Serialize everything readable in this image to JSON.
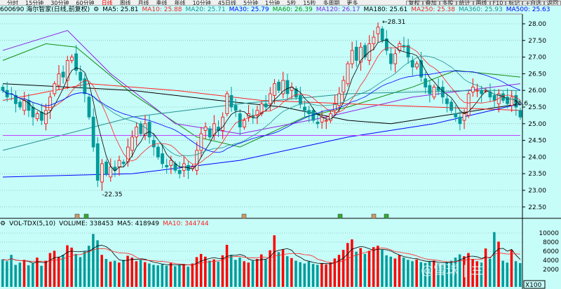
{
  "toolbar": {
    "periods": [
      "分时",
      "15分钟",
      "30分钟",
      "60分钟",
      "日线",
      "周线",
      "月线",
      "季线",
      "年线",
      "10分钟",
      "45日线",
      "5分钟",
      "1分钟",
      "5秒",
      "15秒",
      "多周期",
      "更多"
    ],
    "active": "日线",
    "right_buttons": [
      "复权",
      "叠加",
      "多股",
      "统计",
      "画线",
      "F10",
      "标记",
      "+自选",
      "返回"
    ]
  },
  "legend": {
    "title": "600690 海尔智家(日线,前复权)",
    "ma": [
      {
        "label": "MA5: 25.81",
        "color": "#000000"
      },
      {
        "label": "MA10: 25.88",
        "color": "#ff2020"
      },
      {
        "label": "MA20: 25.71",
        "color": "#209090"
      },
      {
        "label": "MA30: 25.79",
        "color": "#0000ff"
      },
      {
        "label": "MA60: 26.39",
        "color": "#109010"
      },
      {
        "label": "MA120: 26.17",
        "color": "#9020e0"
      },
      {
        "label": "MA180: 25.61",
        "color": "#000000"
      },
      {
        "label": "MA250: 25.38",
        "color": "#ff2020"
      },
      {
        "label": "MA360: 25.93",
        "color": "#209090"
      },
      {
        "label": "MA500: 25.63",
        "color": "#0000ff"
      }
    ]
  },
  "volume_legend": {
    "title": "VOL-TDX(5,10)",
    "volume": "VOLUME: 338453",
    "ma5": "MA5: 418949",
    "ma10": "MA10: 344744"
  },
  "price_axis": [
    "28.00",
    "27.50",
    "27.00",
    "26.50",
    "26.00",
    "25.50",
    "25.00",
    "24.50",
    "24.00",
    "23.50",
    "23.00",
    "22.50"
  ],
  "volume_axis": [
    "10000",
    "8000",
    "6000",
    "4000",
    "2000"
  ],
  "volume_unit": "X100",
  "annotations": {
    "high": "28.31",
    "low": "22.35",
    "last": "25.6"
  },
  "watermark": "@雪球 | 兰",
  "chart_data": {
    "type": "candlestick",
    "colors": {
      "up": "#ff0000",
      "down": "#009a9a"
    },
    "closes": [
      26.0,
      25.8,
      25.9,
      25.6,
      25.5,
      25.7,
      25.4,
      25.2,
      25.3,
      25.1,
      25.4,
      25.8,
      26.2,
      26.5,
      26.4,
      26.9,
      27.0,
      26.6,
      26.3,
      25.9,
      25.2,
      24.3,
      23.3,
      23.8,
      23.5,
      23.7,
      23.6,
      23.9,
      23.8,
      24.3,
      24.6,
      24.9,
      24.7,
      25.0,
      24.6,
      24.3,
      24.0,
      23.8,
      23.7,
      23.9,
      23.6,
      23.5,
      23.8,
      23.6,
      23.7,
      24.2,
      24.7,
      24.9,
      24.6,
      25.0,
      24.8,
      25.2,
      25.9,
      25.5,
      25.4,
      24.9,
      25.1,
      25.3,
      25.2,
      25.4,
      25.6,
      25.5,
      25.9,
      26.2,
      26.0,
      26.3,
      25.9,
      26.1,
      25.8,
      25.6,
      25.4,
      25.3,
      25.1,
      25.0,
      25.2,
      25.1,
      25.3,
      25.6,
      25.9,
      26.3,
      26.8,
      27.2,
      26.9,
      27.3,
      27.0,
      27.4,
      27.6,
      27.9,
      27.5,
      27.2,
      26.8,
      27.1,
      27.4,
      27.3,
      27.0,
      26.7,
      26.8,
      26.4,
      26.1,
      25.9,
      26.1,
      26.0,
      25.8,
      25.6,
      25.4,
      25.2,
      25.0,
      25.3,
      25.9,
      26.1,
      26.0,
      25.9,
      26.0,
      25.8,
      25.7,
      25.9,
      25.7,
      25.6,
      25.8,
      25.5,
      25.2
    ],
    "volumes": [
      4200,
      3800,
      5200,
      3000,
      3500,
      4100,
      2900,
      3300,
      4600,
      2800,
      3900,
      5600,
      6100,
      4800,
      5200,
      7300,
      6800,
      5400,
      4700,
      5900,
      7200,
      9800,
      8400,
      5200,
      4300,
      3700,
      3900,
      3500,
      4100,
      5000,
      4600,
      3800,
      4200,
      3600,
      3300,
      3000,
      2900,
      3100,
      2800,
      3400,
      2700,
      3000,
      3200,
      2600,
      3300,
      4700,
      5400,
      4800,
      3900,
      4200,
      3700,
      5100,
      7400,
      5200,
      4100,
      4600,
      3800,
      3500,
      3900,
      4300,
      5300,
      4200,
      6200,
      9500,
      5800,
      6400,
      4900,
      4500,
      3900,
      3600,
      3300,
      3700,
      3200,
      3000,
      3400,
      3100,
      3500,
      4400,
      5200,
      6300,
      7800,
      8600,
      5900,
      6700,
      5400,
      6100,
      6900,
      7200,
      6300,
      5100,
      4800,
      4400,
      5200,
      4600,
      4100,
      3800,
      4200,
      3600,
      3400,
      3700,
      3900,
      3300,
      3100,
      3600,
      3900,
      4600,
      5300,
      4900,
      5600,
      4200,
      3800,
      3500,
      6600,
      4300,
      10200,
      8100,
      3900,
      3500,
      6300,
      3800,
      3400
    ],
    "overlay_mas": [
      {
        "name": "MA60",
        "color": "#109010",
        "points": [
          [
            0,
            26.9
          ],
          [
            10,
            27.4
          ],
          [
            17,
            27.3
          ],
          [
            30,
            25.9
          ],
          [
            45,
            24.6
          ],
          [
            55,
            24.3
          ],
          [
            70,
            25.2
          ],
          [
            80,
            25.5
          ],
          [
            95,
            26.1
          ],
          [
            105,
            26.6
          ],
          [
            120,
            26.4
          ]
        ]
      },
      {
        "name": "MA120",
        "color": "#9020e0",
        "points": [
          [
            0,
            27.2
          ],
          [
            15,
            27.8
          ],
          [
            25,
            26.5
          ],
          [
            40,
            25.0
          ],
          [
            55,
            24.7
          ],
          [
            75,
            25.2
          ],
          [
            95,
            25.8
          ],
          [
            120,
            26.2
          ]
        ]
      },
      {
        "name": "MA180",
        "color": "#000000",
        "points": [
          [
            0,
            26.2
          ],
          [
            30,
            26.0
          ],
          [
            50,
            25.7
          ],
          [
            65,
            25.5
          ],
          [
            80,
            25.1
          ],
          [
            90,
            25.0
          ],
          [
            105,
            25.3
          ],
          [
            120,
            25.6
          ]
        ]
      },
      {
        "name": "MA250",
        "color": "#ff2020",
        "points": [
          [
            0,
            25.7
          ],
          [
            20,
            26.2
          ],
          [
            40,
            26.0
          ],
          [
            60,
            25.7
          ],
          [
            80,
            25.6
          ],
          [
            100,
            25.5
          ],
          [
            120,
            25.4
          ]
        ]
      },
      {
        "name": "MA360",
        "color": "#209090",
        "points": [
          [
            0,
            24.2
          ],
          [
            30,
            25.2
          ],
          [
            55,
            25.6
          ],
          [
            80,
            25.9
          ],
          [
            110,
            26.0
          ],
          [
            120,
            26.0
          ]
        ]
      },
      {
        "name": "MA500",
        "color": "#0000ff",
        "points": [
          [
            0,
            23.4
          ],
          [
            30,
            23.5
          ],
          [
            55,
            23.9
          ],
          [
            80,
            24.6
          ],
          [
            100,
            25.0
          ],
          [
            120,
            25.6
          ]
        ]
      },
      {
        "name": "level",
        "color": "#c040ff",
        "points": [
          [
            0,
            24.65
          ],
          [
            120,
            24.65
          ]
        ]
      }
    ]
  }
}
